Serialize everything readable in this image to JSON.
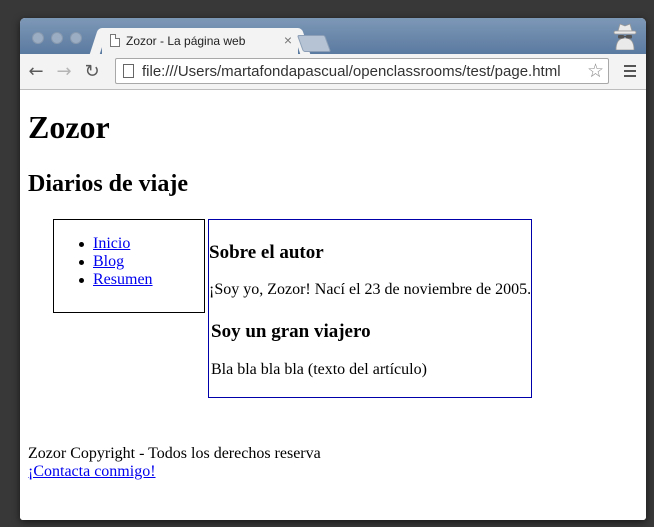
{
  "browser": {
    "tab_title": "Zozor - La página web",
    "tab_close": "×",
    "url": "file:///Users/martafondapascual/openclassrooms/test/page.html",
    "back_icon": "←",
    "forward_icon": "→",
    "reload_icon": "↻",
    "star_icon": "☆"
  },
  "page": {
    "title": "Zozor",
    "subtitle": "Diarios de viaje",
    "nav": {
      "items": [
        {
          "label": "Inicio"
        },
        {
          "label": "Blog"
        },
        {
          "label": "Resumen"
        }
      ]
    },
    "about": {
      "title": "Sobre el autor",
      "text": "¡Soy yo, Zozor! Nací el 23 de noviembre de 2005."
    },
    "article": {
      "title": "Soy un gran viajero",
      "text": "Bla bla bla bla (texto del artículo)"
    },
    "footer": {
      "text": "Zozor Copyright - Todos los derechos reserva",
      "contact_link": "¡Contacta conmigo!"
    }
  },
  "colors": {
    "tabstrip": "#6b88ab",
    "toolbar": "#f3f3f3",
    "link": "#0000ee",
    "aside_border": "#0000aa"
  }
}
